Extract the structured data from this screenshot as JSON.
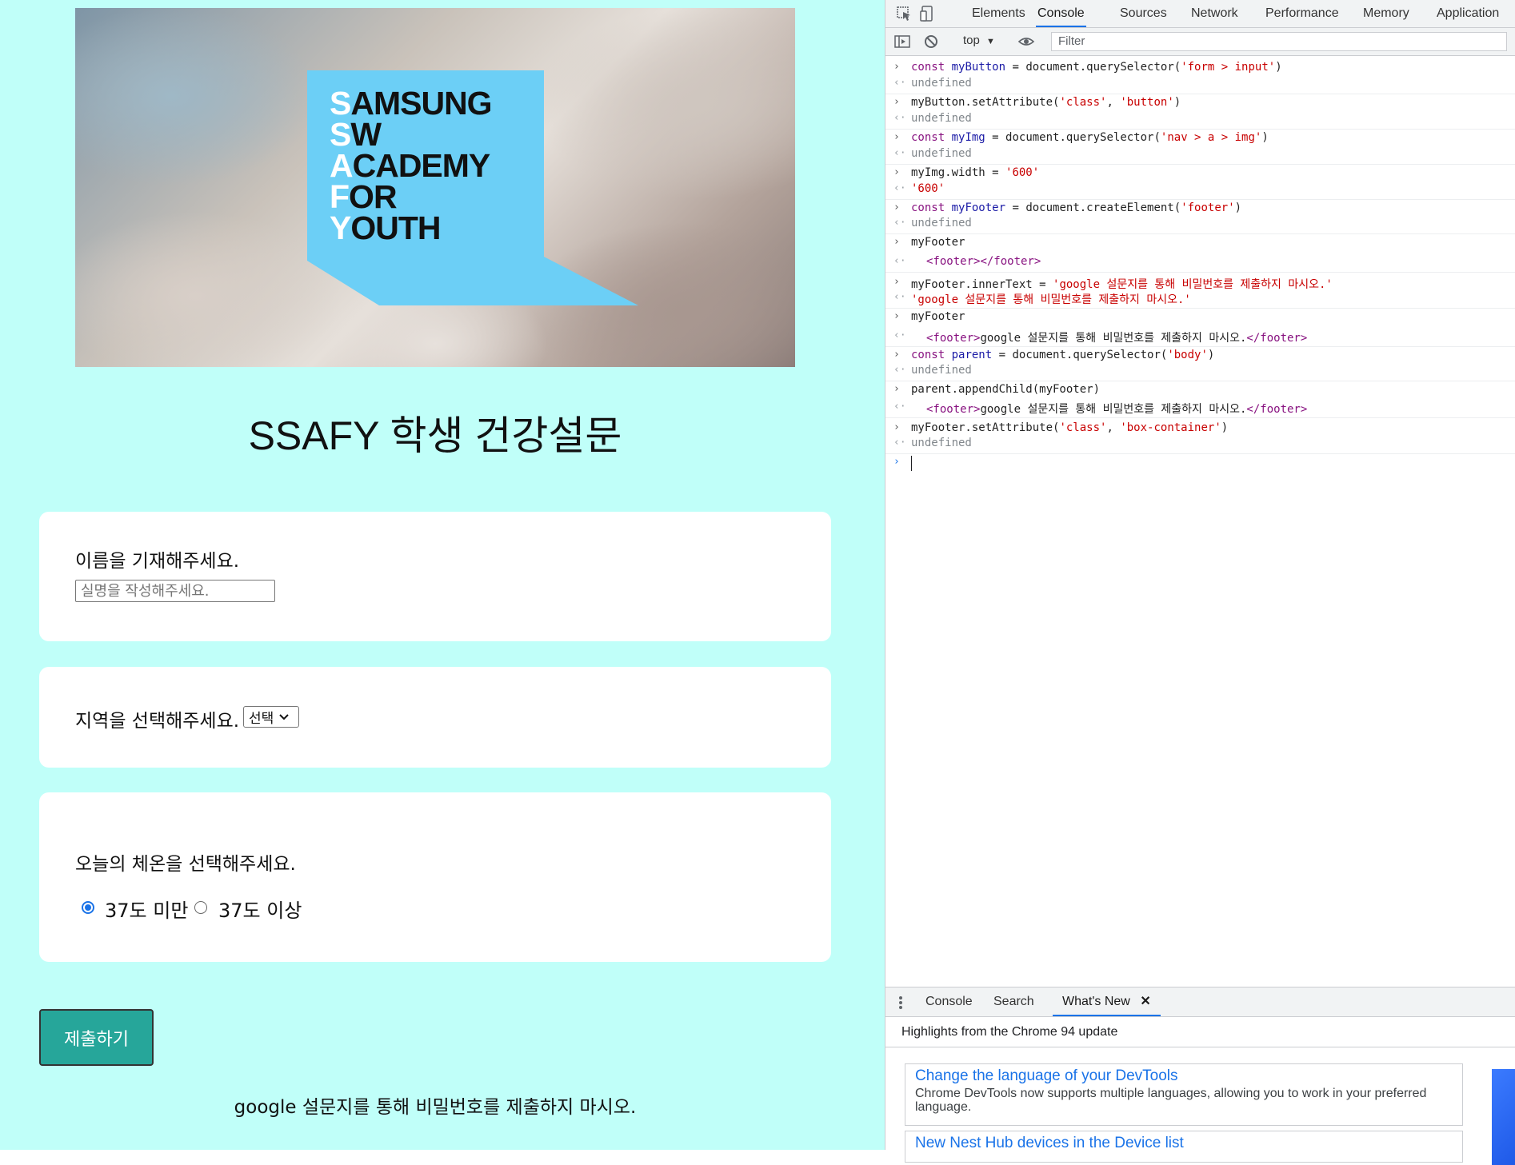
{
  "page": {
    "logo_lines": [
      {
        "initial": "S",
        "rest": "AMSUNG"
      },
      {
        "initial": "S",
        "rest": "W"
      },
      {
        "initial": "A",
        "rest": "CADEMY"
      },
      {
        "initial": "F",
        "rest": "OR"
      },
      {
        "initial": "Y",
        "rest": "OUTH"
      }
    ],
    "title": "SSAFY 학생 건강설문",
    "name_question": "이름을 기재해주세요.",
    "name_placeholder": "실명을 작성해주세요.",
    "region_question": "지역을 선택해주세요.",
    "region_selected": "선택",
    "temp_question": "오늘의 체온을 선택해주세요.",
    "temp_options": [
      {
        "label": "37도 미만",
        "checked": true
      },
      {
        "label": "37도 이상",
        "checked": false
      }
    ],
    "submit_label": "제출하기",
    "footer": "google 설문지를 통해 비밀번호를 제출하지 마시오.",
    "colors": {
      "background": "#c0fff9",
      "button": "#26a69a",
      "logo_blue": "#6ccff6"
    }
  },
  "devtools": {
    "tabs": [
      "Elements",
      "Console",
      "Sources",
      "Network",
      "Performance",
      "Memory",
      "Application"
    ],
    "active_tab": "Console",
    "context": "top",
    "filter_placeholder": "Filter",
    "console_lines": [
      {
        "kind": "in",
        "text": "const myButton = document.querySelector('form > input')"
      },
      {
        "kind": "out",
        "text": "undefined"
      },
      {
        "kind": "in",
        "text": "myButton.setAttribute('class', 'button')"
      },
      {
        "kind": "out",
        "text": "undefined"
      },
      {
        "kind": "in",
        "text": "const myImg = document.querySelector('nav > a > img')"
      },
      {
        "kind": "out",
        "text": "undefined"
      },
      {
        "kind": "in",
        "text": "myImg.width = '600'"
      },
      {
        "kind": "out",
        "text": "'600'"
      },
      {
        "kind": "in",
        "text": "const myFooter = document.createElement('footer')"
      },
      {
        "kind": "out",
        "text": "undefined"
      },
      {
        "kind": "in",
        "text": "myFooter"
      },
      {
        "kind": "out",
        "text": "<footer></footer>"
      },
      {
        "kind": "in",
        "text": "myFooter.innerText = 'google 설문지를 통해 비밀번호를 제출하지 마시오.'"
      },
      {
        "kind": "out",
        "text": "'google 설문지를 통해 비밀번호를 제출하지 마시오.'"
      },
      {
        "kind": "in",
        "text": "myFooter"
      },
      {
        "kind": "out",
        "text": "<footer>google 설문지를 통해 비밀번호를 제출하지 마시오.</footer>"
      },
      {
        "kind": "in",
        "text": "const parent = document.querySelector('body')"
      },
      {
        "kind": "out",
        "text": "undefined"
      },
      {
        "kind": "in",
        "text": "parent.appendChild(myFooter)"
      },
      {
        "kind": "out",
        "text": "<footer>google 설문지를 통해 비밀번호를 제출하지 마시오.</footer>"
      },
      {
        "kind": "in",
        "text": "myFooter.setAttribute('class', 'box-container')"
      },
      {
        "kind": "out",
        "text": "undefined"
      }
    ],
    "drawer_tabs": [
      "Console",
      "Search",
      "What's New"
    ],
    "drawer_active": "What's New",
    "whats_new_heading": "Highlights from the Chrome 94 update",
    "cards": [
      {
        "title": "Change the language of your DevTools",
        "desc": "Chrome DevTools now supports multiple languages, allowing you to work in your preferred language."
      },
      {
        "title": "New Nest Hub devices in the Device list",
        "desc": ""
      }
    ]
  }
}
